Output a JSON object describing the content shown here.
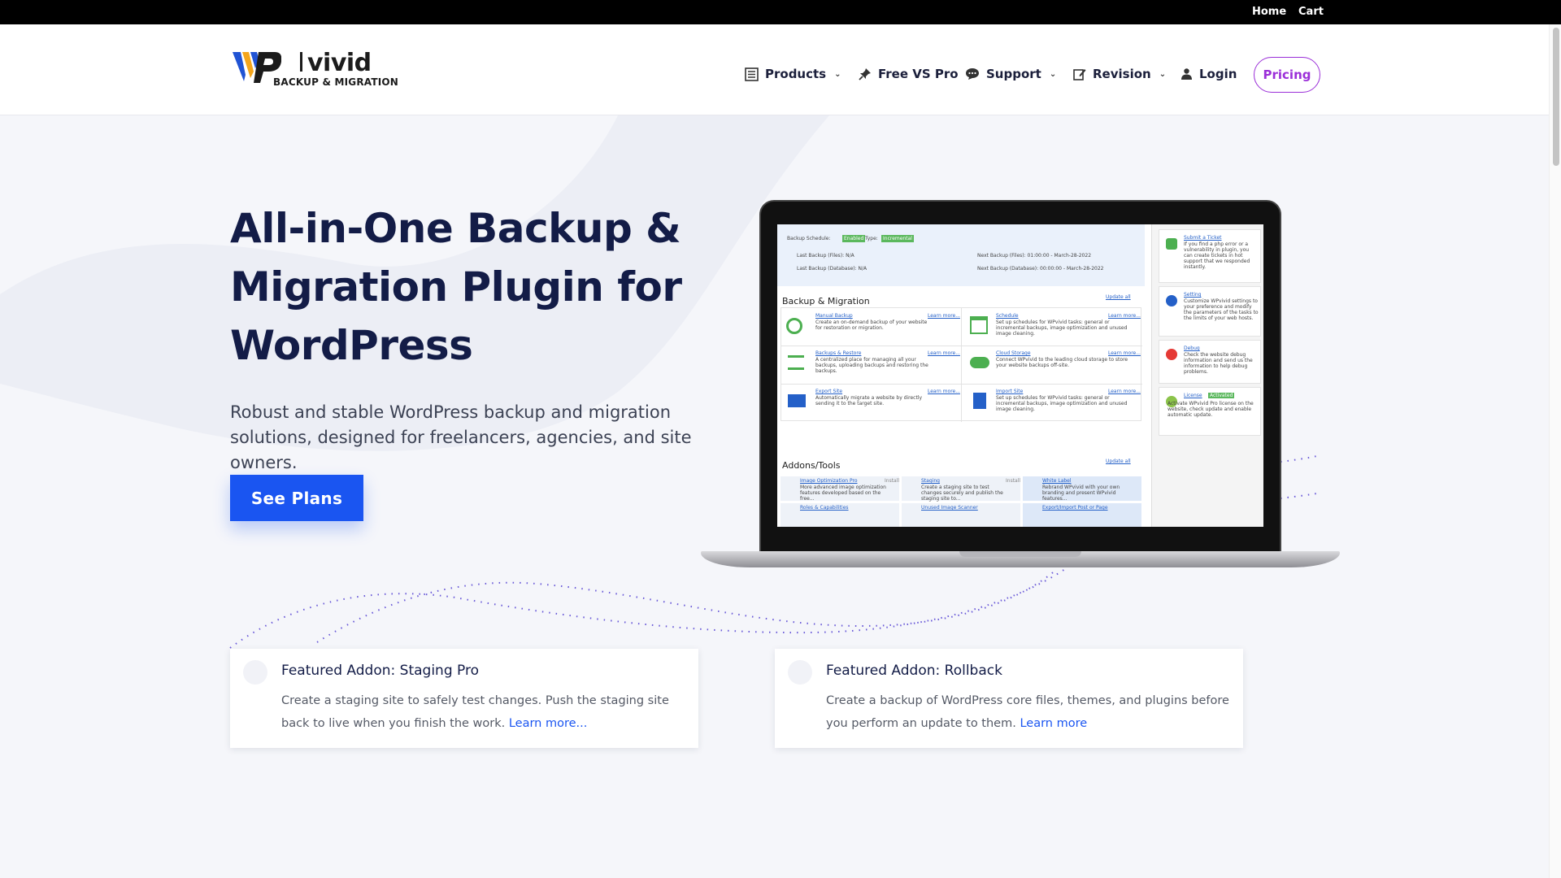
{
  "topbar": {
    "home": "Home",
    "cart": "Cart"
  },
  "logo": {
    "name": "vivid",
    "tagline": "BACKUP & MIGRATION"
  },
  "nav": {
    "products": "Products",
    "free_vs_pro": "Free VS Pro",
    "support": "Support",
    "revision": "Revision",
    "login": "Login",
    "pricing": "Pricing"
  },
  "hero": {
    "title": "All-in-One Backup & Migration Plugin for WordPress",
    "subtitle": "Robust and stable WordPress backup and migration solutions, designed for freelancers, agencies, and site owners.",
    "cta": "See Plans"
  },
  "screen": {
    "schedule_label": "Backup Schedule:",
    "schedule_status": "Enabled",
    "type_label": "Type:",
    "type_value": "Incremental",
    "last_backup_files": "Last Backup (Files): N/A",
    "last_backup_db": "Last Backup (Database): N/A",
    "next_backup_files": "Next Backup (Files): 01:00:00 - March-28-2022",
    "next_backup_db": "Next Backup (Database): 00:00:00 - March-28-2022",
    "section1": "Backup & Migration",
    "section2": "Addons/Tools",
    "update_all": "Update all",
    "learn_more": "Learn more...",
    "items": [
      {
        "title": "Manual Backup",
        "desc": "Create an on-demand backup of your website for restoration or migration."
      },
      {
        "title": "Schedule",
        "desc": "Set up schedules for WPvivid tasks: general or incremental backups, image optimization and unused image cleaning."
      },
      {
        "title": "Backups & Restore",
        "desc": "A centralized place for managing all your backups, uploading backups and restoring the backups."
      },
      {
        "title": "Cloud Storage",
        "desc": "Connect WPvivid to the leading cloud storage to store your website backups off-site."
      },
      {
        "title": "Export Site",
        "desc": "Automatically migrate a website by directly sending it to the target site."
      },
      {
        "title": "Import Site",
        "desc": "Set up schedules for WPvivid tasks: general or incremental backups, image optimization and unused image cleaning."
      }
    ],
    "addons": [
      {
        "title": "Image Optimization Pro",
        "desc": "More advanced image optimization features developed based on the free..."
      },
      {
        "title": "Staging",
        "desc": "Create a staging site to test changes securely and publish the staging site to..."
      },
      {
        "title": "White Label",
        "desc": "Rebrand WPvivid with your own branding and present WPvivid features..."
      },
      {
        "title": "Roles & Capabilities",
        "desc": ""
      },
      {
        "title": "Unused Image Scanner",
        "desc": ""
      },
      {
        "title": "Export/Import Post or Page",
        "desc": ""
      }
    ],
    "install": "Install",
    "side": [
      {
        "title": "Submit a Ticket",
        "desc": "If you find a php error or a vulnerability in plugin, you can create tickets in hot support that we responded instantly."
      },
      {
        "title": "Setting",
        "desc": "Customize WPvivid settings to your preference and modify the parameters of the tasks to the limits of your web hosts."
      },
      {
        "title": "Debug",
        "desc": "Check the website debug information and send us the information to help debug problems."
      },
      {
        "title": "License",
        "badge": "Activated",
        "desc": "Activate WPvivid Pro license on the website, check update and enable automatic update."
      }
    ]
  },
  "features": [
    {
      "title": "Featured Addon: Staging Pro",
      "text": "Create a staging site to safely test changes. Push the staging site back to live when you finish the work.",
      "link": "Learn more..."
    },
    {
      "title": "Featured Addon: Rollback",
      "text": "Create a backup of WordPress core files, themes, and plugins before you perform an update to them.",
      "link": "Learn more"
    }
  ],
  "colors": {
    "accent": "#1a55f1",
    "pricing": "#9b2fd8",
    "heading": "#131c47"
  }
}
